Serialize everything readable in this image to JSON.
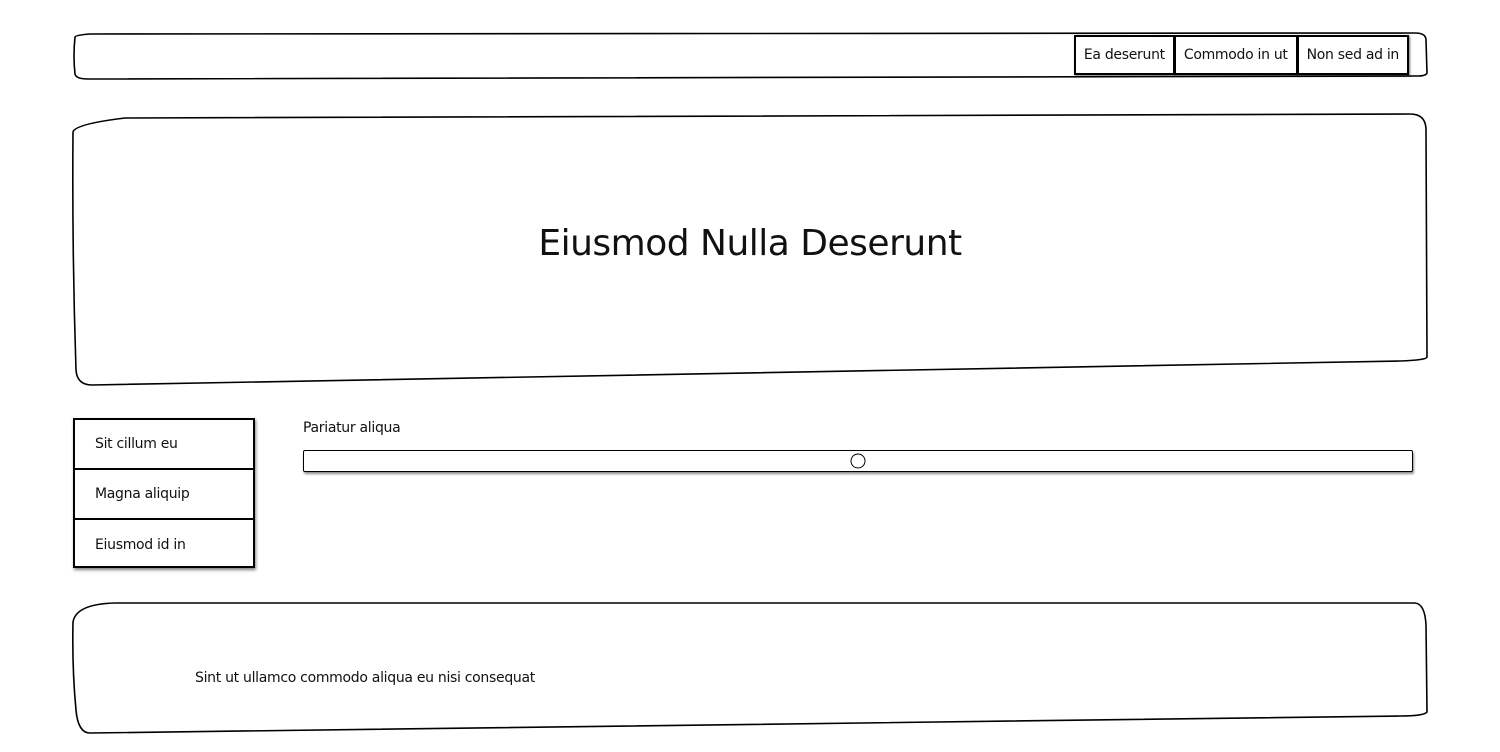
{
  "nav": {
    "items": [
      {
        "label": "Ea deserunt"
      },
      {
        "label": "Commodo in ut"
      },
      {
        "label": "Non sed ad in"
      }
    ]
  },
  "hero": {
    "title": "Eiusmod Nulla Deserunt"
  },
  "sidebar": {
    "items": [
      {
        "label": "Sit cillum eu"
      },
      {
        "label": "Magna aliquip"
      },
      {
        "label": "Eiusmod id in"
      }
    ]
  },
  "slider": {
    "label": "Pariatur aliqua",
    "value": 0.5
  },
  "footer": {
    "text": "Sint ut ullamco commodo aliqua eu nisi consequat"
  }
}
